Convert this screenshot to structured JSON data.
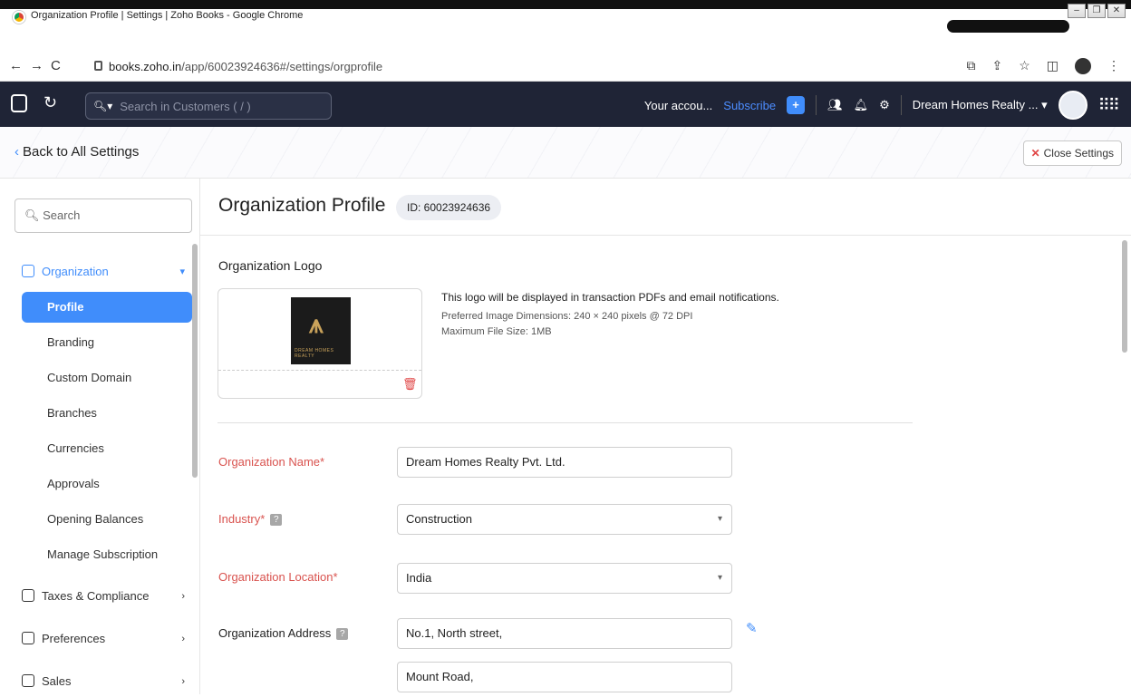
{
  "browser": {
    "window_title": "Organization Profile | Settings | Zoho Books - Google Chrome",
    "url_host": "books.zoho.in",
    "url_path": "/app/60023924636#/settings/orgprofile"
  },
  "appbar": {
    "search_placeholder": "Search in Customers ( / )",
    "account_text": "Your accou...",
    "subscribe_label": "Subscribe",
    "org_name": "Dream Homes Realty ... ▾"
  },
  "settings_bar": {
    "back_label": "Back to All Settings",
    "close_label": "Close Settings"
  },
  "sidebar": {
    "search_placeholder": "Search",
    "items": [
      {
        "label": "Organization"
      },
      {
        "label": "Profile"
      },
      {
        "label": "Branding"
      },
      {
        "label": "Custom Domain"
      },
      {
        "label": "Branches"
      },
      {
        "label": "Currencies"
      },
      {
        "label": "Approvals"
      },
      {
        "label": "Opening Balances"
      },
      {
        "label": "Manage Subscription"
      },
      {
        "label": "Taxes & Compliance"
      },
      {
        "label": "Preferences"
      },
      {
        "label": "Sales"
      }
    ]
  },
  "main": {
    "title": "Organization Profile",
    "id_badge": "ID: 60023924636",
    "logo_section_title": "Organization Logo",
    "logo_brand_text": "DREAM HOMES REALTY",
    "logo_info_line1": "This logo will be displayed in transaction PDFs and email notifications.",
    "logo_info_line2": "Preferred Image Dimensions: 240 × 240 pixels @ 72 DPI",
    "logo_info_line3": "Maximum File Size: 1MB",
    "fields": {
      "org_name_label": "Organization Name*",
      "org_name_value": "Dream Homes Realty Pvt. Ltd.",
      "industry_label": "Industry*",
      "industry_value": "Construction",
      "location_label": "Organization Location*",
      "location_value": "India",
      "address_label": "Organization Address",
      "address_line1": "No.1, North street,",
      "address_line2": "Mount Road,"
    }
  }
}
